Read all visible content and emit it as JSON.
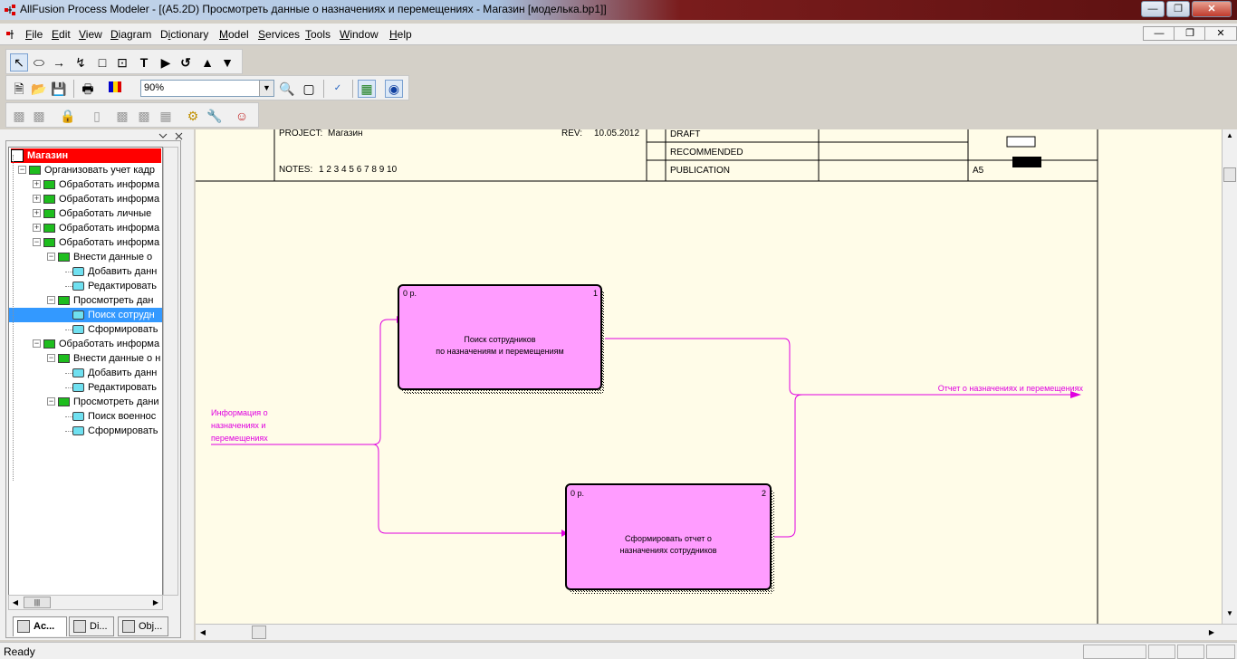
{
  "window": {
    "title": "AllFusion Process Modeler - [(A5.2D) Просмотреть данные о назначениях и перемещениях - Магазин  [моделька.bp1]]"
  },
  "menu": {
    "items": [
      {
        "label": "File",
        "accel": "F"
      },
      {
        "label": "Edit",
        "accel": "E"
      },
      {
        "label": "View",
        "accel": "V"
      },
      {
        "label": "Diagram",
        "accel": "D"
      },
      {
        "label": "Dictionary",
        "accel": "i"
      },
      {
        "label": "Model",
        "accel": "M"
      },
      {
        "label": "Services",
        "accel": "S"
      },
      {
        "label": "Tools",
        "accel": "T"
      },
      {
        "label": "Window",
        "accel": "W"
      },
      {
        "label": "Help",
        "accel": "H"
      }
    ]
  },
  "toolbar": {
    "zoom_value": "90%"
  },
  "tree": {
    "root": "Магазин",
    "nodes": [
      "Организовать учет кадр",
      "Обработать информа",
      "Обработать информа",
      "Обработать  личные",
      "Обработать информа",
      "Обработать информа",
      "Внести данные  о",
      "Добавить данн",
      "Редактировать",
      "Просмотреть дан",
      "Поиск сотрудн",
      "Сформировать",
      "Обработать информа",
      "Внести данные о н",
      "Добавить данн",
      "Редактировать",
      "Просмотреть дани",
      "Поиск военнос",
      "Сформировать"
    ]
  },
  "tabs": {
    "activities": "Ac...",
    "diagrams": "Di...",
    "objects": "Obj..."
  },
  "frame": {
    "project_label": "PROJECT:",
    "project": "Магазин",
    "rev_label": "REV:",
    "rev": "10.05.2012",
    "notes_label": "NOTES:",
    "notes": "1  2  3  4  5  6  7  8  9  10",
    "status": [
      "DRAFT",
      "RECOMMENDED",
      "PUBLICATION"
    ],
    "node": "A5"
  },
  "diagram": {
    "box1": {
      "cost": "0 р.",
      "number": "1",
      "line1": "Поиск сотрудников",
      "line2": "по назначениям и перемещениям"
    },
    "box2": {
      "cost": "0 р.",
      "number": "2",
      "line1": "Сформировать отчет о",
      "line2": "назначениях сотрудников"
    },
    "input_label": [
      "Информация о",
      "назначениях и",
      "перемещениях"
    ],
    "output_label": "Отчет о назначениях и перемещениях",
    "colors": {
      "box_fill": "#ff9cff",
      "arrow": "#e000e0",
      "canvas": "#fffce8"
    }
  },
  "status": {
    "text": "Ready"
  }
}
